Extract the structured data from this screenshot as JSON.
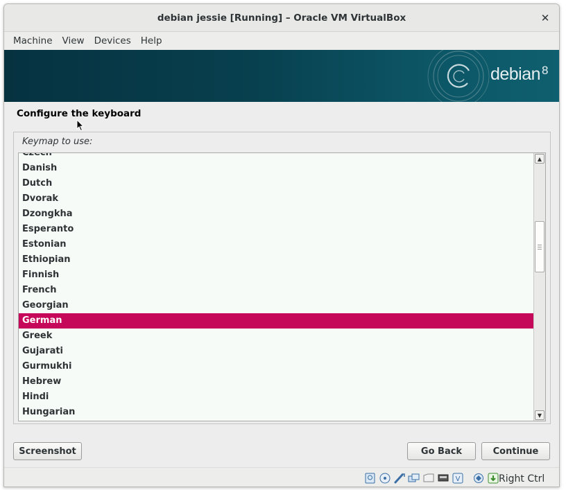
{
  "window": {
    "title": "debian jessie [Running] – Oracle VM VirtualBox",
    "close_glyph": "✕"
  },
  "menubar": {
    "items": [
      {
        "label": "Machine"
      },
      {
        "label": "View"
      },
      {
        "label": "Devices"
      },
      {
        "label": "Help"
      }
    ]
  },
  "banner": {
    "brand": "debian",
    "version": "8",
    "logo_icon": "debian-swirl-icon"
  },
  "installer": {
    "page_title": "Configure the keyboard",
    "keymap_label": "Keymap to use:",
    "keymaps": [
      {
        "label": "Czech",
        "selected": false
      },
      {
        "label": "Danish",
        "selected": false
      },
      {
        "label": "Dutch",
        "selected": false
      },
      {
        "label": "Dvorak",
        "selected": false
      },
      {
        "label": "Dzongkha",
        "selected": false
      },
      {
        "label": "Esperanto",
        "selected": false
      },
      {
        "label": "Estonian",
        "selected": false
      },
      {
        "label": "Ethiopian",
        "selected": false
      },
      {
        "label": "Finnish",
        "selected": false
      },
      {
        "label": "French",
        "selected": false
      },
      {
        "label": "Georgian",
        "selected": false
      },
      {
        "label": "German",
        "selected": true
      },
      {
        "label": "Greek",
        "selected": false
      },
      {
        "label": "Gujarati",
        "selected": false
      },
      {
        "label": "Gurmukhi",
        "selected": false
      },
      {
        "label": "Hebrew",
        "selected": false
      },
      {
        "label": "Hindi",
        "selected": false
      },
      {
        "label": "Hungarian",
        "selected": false
      }
    ],
    "buttons": {
      "screenshot": "Screenshot",
      "go_back": "Go Back",
      "continue": "Continue"
    }
  },
  "statusbar": {
    "icons": [
      "hard-disk-icon",
      "optical-drive-icon",
      "usb-icon",
      "shared-folders-icon",
      "display-icon",
      "network-icon",
      "video-capture-icon",
      "cpu-virtualization-icon",
      "mouse-integration-icon"
    ],
    "host_key": "Right Ctrl"
  },
  "colors": {
    "selection": "#c6085a",
    "banner": "#063240"
  }
}
